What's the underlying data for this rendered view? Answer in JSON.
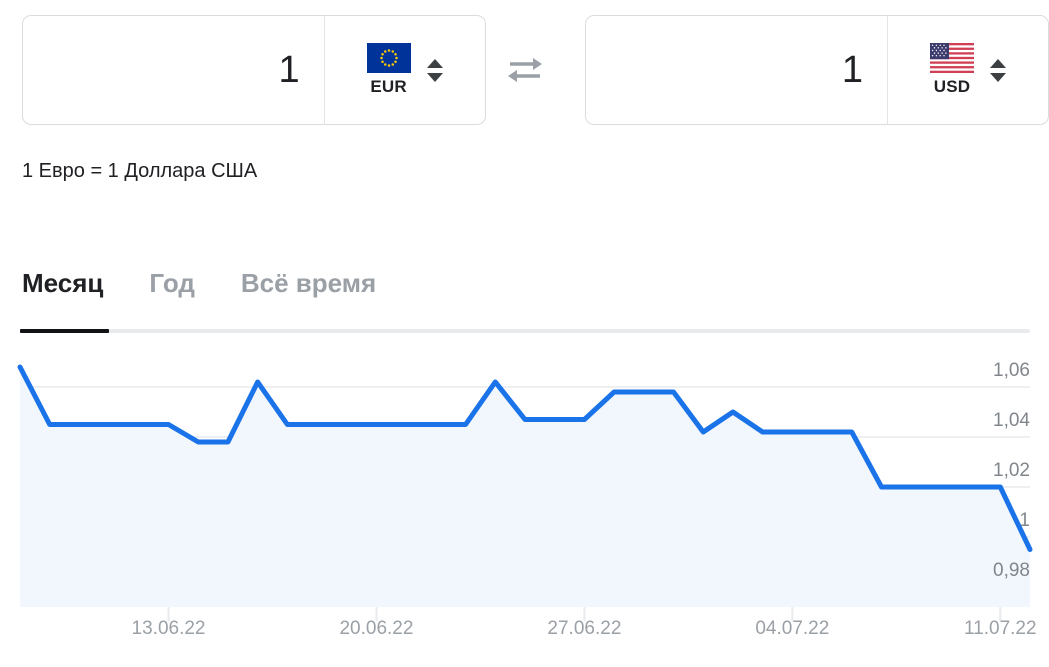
{
  "converter": {
    "swap_icon": "swap-horizontal-arrows-icon",
    "from": {
      "amount": "1",
      "currency_code": "EUR",
      "flag_icon": "flag-eu-icon",
      "spinner_icon": "spinner-up-down-icon"
    },
    "to": {
      "amount": "1",
      "currency_code": "USD",
      "flag_icon": "flag-us-icon",
      "spinner_icon": "spinner-up-down-icon"
    }
  },
  "subtitle": "1 Евро = 1 Доллара США",
  "tabs": [
    {
      "label": "Месяц",
      "active": true
    },
    {
      "label": "Год",
      "active": false
    },
    {
      "label": "Всё время",
      "active": false
    }
  ],
  "colors": {
    "line": "#1a73e8",
    "area": "#f2f7fd",
    "grid": "#edeff1",
    "axis_text": "#80868b",
    "active_tab": "#202124",
    "inactive_tab": "#9aa0a6"
  },
  "chart_data": {
    "type": "line",
    "title": "",
    "xlabel": "",
    "ylabel": "",
    "grid": true,
    "legend": "none",
    "ylim": [
      0.97,
      1.07
    ],
    "ytick_labels": [
      "1,06",
      "1,04",
      "1,02",
      "1",
      "0,98"
    ],
    "ytick_values": [
      1.06,
      1.04,
      1.02,
      1.0,
      0.98
    ],
    "xtick_labels": [
      "13.06.22",
      "20.06.22",
      "27.06.22",
      "04.07.22",
      "11.07.22"
    ],
    "xlim": [
      "08.06.22",
      "12.07.22"
    ],
    "series": [
      {
        "name": "EUR/USD",
        "x": [
          "08.06.22",
          "09.06.22",
          "10.06.22",
          "11.06.22",
          "12.06.22",
          "13.06.22",
          "14.06.22",
          "15.06.22",
          "16.06.22",
          "17.06.22",
          "18.06.22",
          "19.06.22",
          "20.06.22",
          "21.06.22",
          "22.06.22",
          "23.06.22",
          "24.06.22",
          "25.06.22",
          "26.06.22",
          "27.06.22",
          "28.06.22",
          "29.06.22",
          "30.06.22",
          "01.07.22",
          "02.07.22",
          "03.07.22",
          "04.07.22",
          "05.07.22",
          "06.07.22",
          "07.07.22",
          "08.07.22",
          "09.07.22",
          "10.07.22",
          "11.07.22",
          "12.07.22"
        ],
        "values": [
          1.068,
          1.045,
          1.045,
          1.045,
          1.045,
          1.045,
          1.038,
          1.038,
          1.062,
          1.045,
          1.045,
          1.045,
          1.045,
          1.045,
          1.045,
          1.045,
          1.062,
          1.047,
          1.047,
          1.047,
          1.058,
          1.058,
          1.058,
          1.042,
          1.05,
          1.042,
          1.042,
          1.042,
          1.042,
          1.02,
          1.02,
          1.02,
          1.02,
          1.02,
          0.995
        ]
      }
    ]
  }
}
